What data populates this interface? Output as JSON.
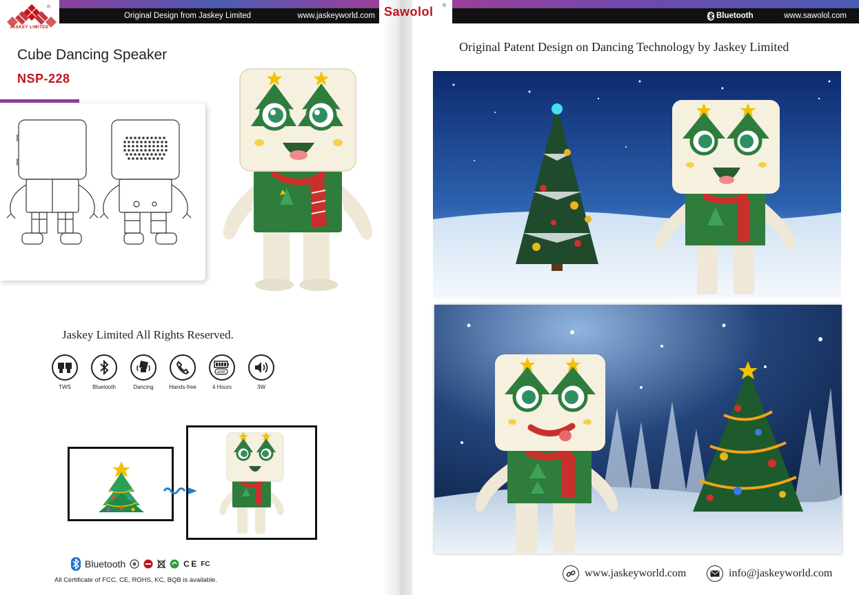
{
  "left": {
    "logo": {
      "caption": "JASKEY  LIMITED",
      "reg_mark": "®"
    },
    "header": {
      "tagline": "Original Design from Jaskey Limited",
      "url": "www.jaskeyworld.com"
    },
    "product_title": "Cube Dancing Speaker",
    "model": "NSP-228",
    "rights": "Jaskey Limited All Rights Reserved.",
    "features": [
      {
        "label": "TWS",
        "icon": "tws-speakers-icon"
      },
      {
        "label": "Bluetooth",
        "icon": "bluetooth-icon"
      },
      {
        "label": "Dancing",
        "icon": "dancing-icon"
      },
      {
        "label": "Hands-free",
        "icon": "phone-icon"
      },
      {
        "label": "4 Hours",
        "icon": "battery-icon",
        "badge": "4HR"
      },
      {
        "label": "3W",
        "icon": "speaker-volume-icon"
      }
    ],
    "certs": {
      "bluetooth_word": "Bluetooth",
      "ce_mark": "C E",
      "fc_mark": "FC",
      "note": "All  Certificate of FCC, CE, ROHS, KC, BQB  is available."
    }
  },
  "right": {
    "brand": "Sawolol",
    "brand_reg": "®",
    "header": {
      "bluetooth_word": "Bluetooth",
      "url": "www.sawolol.com"
    },
    "subtitle": "Original Patent Design on Dancing Technology by Jaskey Limited",
    "contacts": {
      "web": "www.jaskeyworld.com",
      "email": "info@jaskeyworld.com"
    }
  },
  "colors": {
    "brand_red": "#c0141b",
    "accent_purple": "#8a3f9a",
    "robot_green": "#2e7d3c",
    "robot_cream": "#f6f0df"
  }
}
